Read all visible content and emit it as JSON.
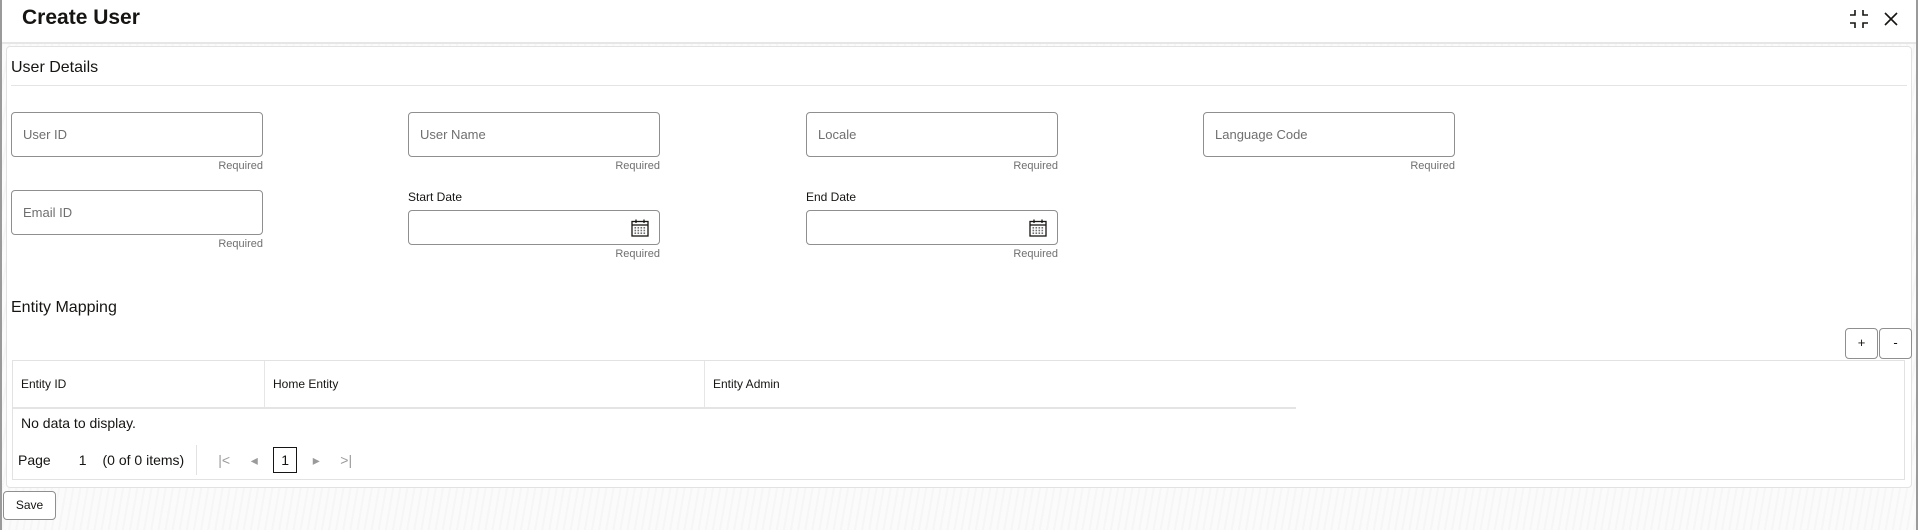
{
  "header": {
    "title": "Create User",
    "icons": [
      "minimize-icon",
      "close-icon"
    ]
  },
  "user_details": {
    "title": "User Details",
    "fields": [
      {
        "placeholder": "User ID",
        "value": "",
        "hint": "Required"
      },
      {
        "placeholder": "User Name",
        "value": "",
        "hint": "Required"
      },
      {
        "placeholder": "Locale",
        "value": "",
        "hint": "Required"
      },
      {
        "placeholder": "Language Code",
        "value": "",
        "hint": "Required"
      },
      {
        "placeholder": "Email ID",
        "value": "",
        "hint": "Required"
      }
    ],
    "date_fields": [
      {
        "label": "Start Date",
        "value": "",
        "hint": "Required",
        "icon": "calendar-icon"
      },
      {
        "label": "End Date",
        "value": "",
        "hint": "Required",
        "icon": "calendar-icon"
      }
    ]
  },
  "entity_mapping": {
    "title": "Entity Mapping",
    "add_label": "+",
    "remove_label": "-",
    "columns": [
      "Entity ID",
      "Home Entity",
      "Entity Admin"
    ],
    "rows": [],
    "empty_text": "No data to display.",
    "pagination": {
      "page_label": "Page",
      "page_value": "1",
      "items_text": "(0 of 0 items)",
      "current_page": "1"
    }
  },
  "footer": {
    "save_label": "Save"
  }
}
